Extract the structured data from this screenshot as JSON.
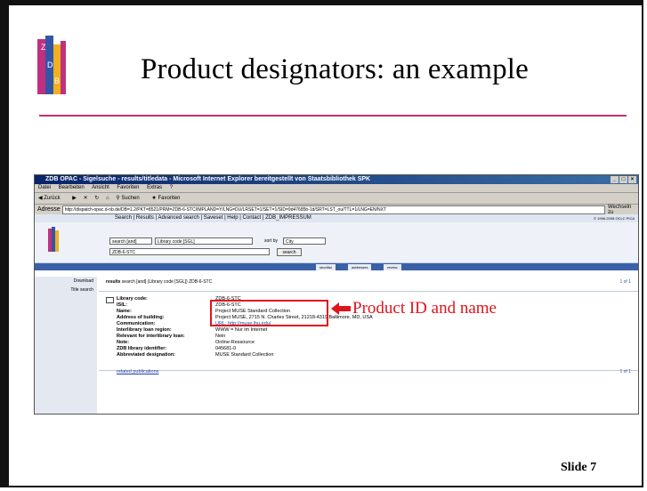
{
  "slide": {
    "title": "Product designators: an example",
    "number": "Slide 7",
    "callout": "Product ID and name",
    "accent_color": "#c0307f",
    "callout_color": "#e0141c"
  },
  "browser": {
    "window_title": "ZDB OPAC - Sigelsuche - results/titledata - Microsoft Internet Explorer bereitgestellt von Staatsbibliothek SPK",
    "menu": [
      "Datei",
      "Bearbeiten",
      "Ansicht",
      "Favoriten",
      "Extras",
      "?"
    ],
    "toolbar": [
      "Zurück",
      "Suchen",
      "Favoriten"
    ],
    "address_label": "Adresse",
    "address_url": "http://dispatch-opac.d-nb.de/DB=1.2/PKT=8521/PRM=ZDB-6-STC/IMPLAND=Y/LNG=DU/LRSET=1/SET=1/SID=9d47685b-1d/SRT=LST_ou/TTL=1/LNG=EN/NXT",
    "go_label": "Wechseln zu"
  },
  "opac": {
    "nav": "Search  |  Results  |  Advanced search  |  Saveset  |  Help                                        |  Contact  |  ZDB_IMPRESSUM",
    "copyright": "© 1996-2008 OCLC PICA",
    "search_mode": "search [and]",
    "search_field": "Library code [SGL]",
    "sort_label": "sort by",
    "sort_value": "City",
    "search_term": "ZDB-6-STC",
    "search_button": "search",
    "tabs": [
      "shortlist",
      "addresses",
      "review"
    ],
    "sidebar": [
      "Download",
      "Title search"
    ],
    "results_prefix": "results",
    "results_query": "search [and] (Library code [SGL]) ZDB-6-STC",
    "page_count": "1 of 1",
    "record": [
      {
        "label": "Library code:",
        "value": "ZDB-6-STC"
      },
      {
        "label": "ISIL:",
        "value": "ZDB-6-STC"
      },
      {
        "label": "Name:",
        "value": "Project MUSE Standard Collection"
      },
      {
        "label": "Address of building:",
        "value": "Project MUSE, 2715 N. Charles Street, 21218-4319 Baltimore, MD, USA"
      },
      {
        "label": "Communication:",
        "value": "URL: http://muse.jhu.edu/"
      },
      {
        "label": "Interlibrary loan region:",
        "value": "WWW = Nur im Internet"
      },
      {
        "label": "Relevant for interlibrary loan:",
        "value": "Nein"
      },
      {
        "label": "Note:",
        "value": "Online-Ressource"
      },
      {
        "label": "ZDB library identifier:",
        "value": "045681-0"
      },
      {
        "label": "Abbreviated designation:",
        "value": "MUSE Standard Collection"
      }
    ],
    "related": "related publications",
    "page_count_bottom": "1 of 1"
  }
}
